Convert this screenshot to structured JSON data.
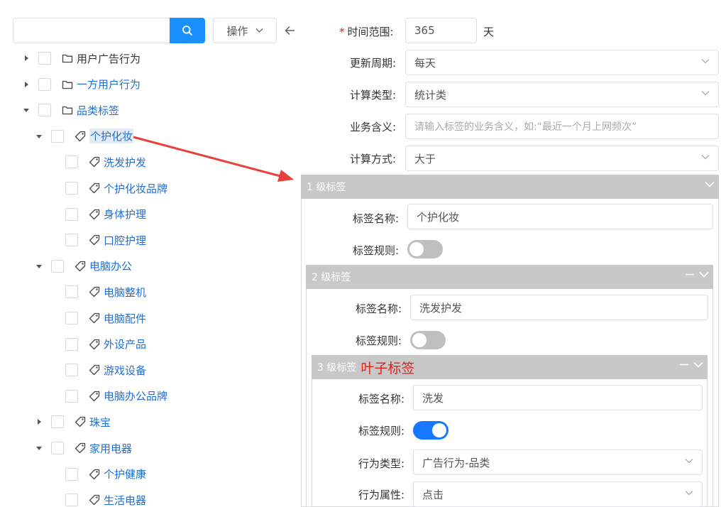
{
  "search": {
    "placeholder": ""
  },
  "toolbar": {
    "ops_label": "操作"
  },
  "tree": [
    {
      "label": "用户广告行为",
      "level": 0,
      "caret": "right",
      "icon": "folder",
      "style": "normal"
    },
    {
      "label": "一方用户行为",
      "level": 0,
      "caret": "right",
      "icon": "folder",
      "style": "blue"
    },
    {
      "label": "品类标签",
      "level": 0,
      "caret": "down",
      "icon": "folder",
      "style": "blue"
    },
    {
      "label": "个护化妆",
      "level": 1,
      "caret": "down",
      "icon": "tag",
      "style": "selected"
    },
    {
      "label": "洗发护发",
      "level": 2,
      "caret": "none",
      "icon": "tag",
      "style": "blue"
    },
    {
      "label": "个护化妆品牌",
      "level": 2,
      "caret": "none",
      "icon": "tag",
      "style": "blue"
    },
    {
      "label": "身体护理",
      "level": 2,
      "caret": "none",
      "icon": "tag",
      "style": "blue"
    },
    {
      "label": "口腔护理",
      "level": 2,
      "caret": "none",
      "icon": "tag",
      "style": "blue"
    },
    {
      "label": "电脑办公",
      "level": 1,
      "caret": "down",
      "icon": "tag",
      "style": "blue"
    },
    {
      "label": "电脑整机",
      "level": 2,
      "caret": "none",
      "icon": "tag",
      "style": "blue"
    },
    {
      "label": "电脑配件",
      "level": 2,
      "caret": "none",
      "icon": "tag",
      "style": "blue"
    },
    {
      "label": "外设产品",
      "level": 2,
      "caret": "none",
      "icon": "tag",
      "style": "blue"
    },
    {
      "label": "游戏设备",
      "level": 2,
      "caret": "none",
      "icon": "tag",
      "style": "blue"
    },
    {
      "label": "电脑办公品牌",
      "level": 2,
      "caret": "none",
      "icon": "tag",
      "style": "blue"
    },
    {
      "label": "珠宝",
      "level": 1,
      "caret": "right",
      "icon": "tag",
      "style": "blue"
    },
    {
      "label": "家用电器",
      "level": 1,
      "caret": "down",
      "icon": "tag",
      "style": "blue"
    },
    {
      "label": "个护健康",
      "level": 2,
      "caret": "none",
      "icon": "tag",
      "style": "blue"
    },
    {
      "label": "生活电器",
      "level": 2,
      "caret": "none",
      "icon": "tag",
      "style": "blue"
    }
  ],
  "form": {
    "time_range": {
      "label": "时间范围:",
      "required": "*",
      "value": "365",
      "unit": "天"
    },
    "update_cycle": {
      "label": "更新周期:",
      "value": "每天"
    },
    "calc_type": {
      "label": "计算类型:",
      "value": "统计类"
    },
    "biz_meaning": {
      "label": "业务含义:",
      "placeholder": "请输入标签的业务含义，如:“最近一个月上网频次”"
    },
    "calc_method": {
      "label": "计算方式:",
      "value": "大于"
    }
  },
  "level1": {
    "title": "1 级标签",
    "name_label": "标签名称:",
    "name_value": "个护化妆",
    "rule_label": "标签规则:",
    "rule_on": false
  },
  "level2": {
    "title": "2 级标签",
    "name_label": "标签名称:",
    "name_value": "洗发护发",
    "rule_label": "标签规则:",
    "rule_on": false
  },
  "level3": {
    "title": "3 级标签",
    "leaf_badge": "叶子标签",
    "name_label": "标签名称:",
    "name_value": "洗发",
    "rule_label": "标签规则:",
    "rule_on": true,
    "behavior_type_label": "行为类型:",
    "behavior_type_value": "广告行为-品类",
    "behavior_attr_label": "行为属性:",
    "behavior_attr_value": "点击"
  },
  "colors": {
    "primary": "#1890ff",
    "switch_on": "#1677ff",
    "panel_header": "#c8c8c8",
    "annotation_arrow": "#e8413c",
    "leaf_badge": "#e0201c",
    "link": "#1f6fd6"
  }
}
